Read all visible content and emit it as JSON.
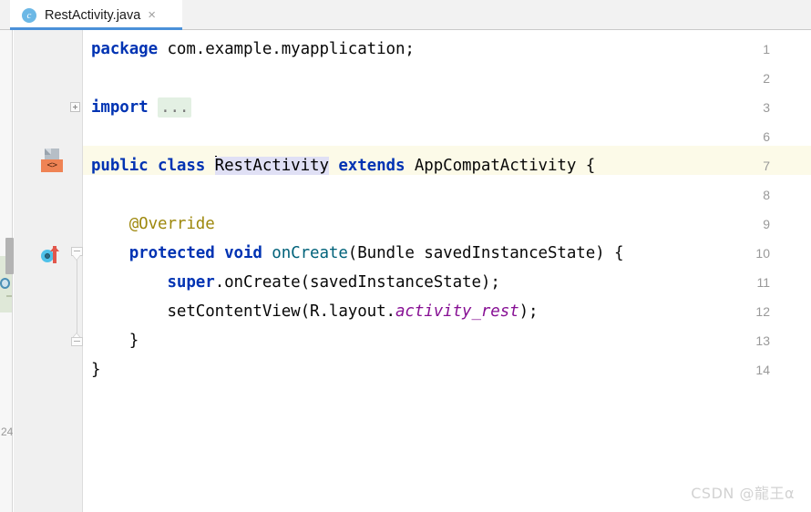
{
  "window": {
    "app": "Android Studio Editor",
    "background_color": "#ffffff"
  },
  "tabbar": {
    "background_color": "#f2f2f2",
    "active_tab_underline_color": "#4a90d9",
    "tabs": [
      {
        "label": "RestActivity.java",
        "icon": "java-class-icon",
        "icon_glyph": "c",
        "icon_color": "#6cb8e6",
        "close_glyph": "×",
        "active": true
      }
    ]
  },
  "gutter": {
    "background_color": "#f0f0f0",
    "line_numbers": [
      "1",
      "2",
      "3",
      "6",
      "7",
      "8",
      "9",
      "10",
      "11",
      "12",
      "13",
      "14"
    ],
    "caret_line_number": "7",
    "caret_line_highlight_color": "#fcfae8",
    "icons": [
      {
        "name": "android-layout-gutter-icon",
        "line": "7",
        "badge_text": "<>",
        "badge_color": "#ef8354"
      },
      {
        "name": "overriding-method-gutter-icon",
        "line": "10",
        "ring_color": "#4fc1e9",
        "arrow_color": "#e2574c"
      }
    ],
    "fold_markers": [
      {
        "name": "fold-expand-imports",
        "line": "3",
        "glyph": "+",
        "state": "collapsed"
      },
      {
        "name": "fold-collapse-method-start",
        "line": "10",
        "glyph": "−",
        "state": "expanded"
      },
      {
        "name": "fold-collapse-method-end",
        "line": "13",
        "glyph": "−",
        "state": "expanded"
      }
    ]
  },
  "left_strip": {
    "scrollbar_thumb_color": "#b3b3b3",
    "partial_line_number": "24",
    "vcs_marker_color": "#dfe8d8"
  },
  "editor": {
    "language": "Java",
    "selected_text": "RestActivity",
    "selection_color": "#e0e0f5",
    "caret_before_selection": true,
    "lines": [
      {
        "number": "1",
        "tokens": [
          {
            "text": "package ",
            "style": "kw"
          },
          {
            "text": "com.example.myapplication;",
            "style": "plain"
          }
        ]
      },
      {
        "number": "2",
        "tokens": []
      },
      {
        "number": "3",
        "tokens": [
          {
            "text": "import ",
            "style": "kw"
          },
          {
            "text": "...",
            "style": "fold-ellipsis"
          }
        ]
      },
      {
        "number": "6",
        "tokens": []
      },
      {
        "number": "7",
        "tokens": [
          {
            "text": "public class ",
            "style": "kw"
          },
          {
            "text": "RestActivity",
            "style": "sel"
          },
          {
            "text": " ",
            "style": "plain"
          },
          {
            "text": "extends",
            "style": "kw"
          },
          {
            "text": " AppCompatActivity {",
            "style": "plain"
          }
        ]
      },
      {
        "number": "8",
        "tokens": []
      },
      {
        "number": "9",
        "tokens": [
          {
            "text": "    @Override",
            "style": "anno"
          }
        ]
      },
      {
        "number": "10",
        "tokens": [
          {
            "text": "    ",
            "style": "plain"
          },
          {
            "text": "protected void ",
            "style": "kw"
          },
          {
            "text": "onCreate",
            "style": "meth"
          },
          {
            "text": "(Bundle savedInstanceState) {",
            "style": "plain"
          }
        ]
      },
      {
        "number": "11",
        "tokens": [
          {
            "text": "        ",
            "style": "plain"
          },
          {
            "text": "super",
            "style": "kw"
          },
          {
            "text": ".onCreate(savedInstanceState);",
            "style": "plain"
          }
        ]
      },
      {
        "number": "12",
        "tokens": [
          {
            "text": "        setContentView(R.layout.",
            "style": "plain"
          },
          {
            "text": "activity_rest",
            "style": "field"
          },
          {
            "text": ");",
            "style": "plain"
          }
        ]
      },
      {
        "number": "13",
        "tokens": [
          {
            "text": "    }",
            "style": "plain"
          }
        ]
      },
      {
        "number": "14",
        "tokens": [
          {
            "text": "}",
            "style": "plain"
          }
        ]
      }
    ]
  },
  "watermark": {
    "text": "CSDN @龍王α"
  }
}
